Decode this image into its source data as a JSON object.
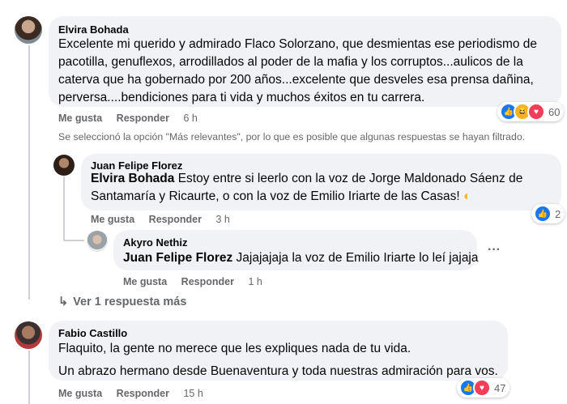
{
  "comments": [
    {
      "author": "Elvira Bohada",
      "text": "Excelente mi querido y admirado Flaco Solorzano, que desmientas ese periodismo de pacotilla, genuflexos, arrodillados al poder de la mafia y los corruptos...aulicos de la caterva que ha gobernado por 200 años...excelente que desveles esa prensa dañina, perversa....bendiciones para ti vida y muchos éxitos en tu carrera.",
      "like_label": "Me gusta",
      "reply_label": "Responder",
      "time": "6 h",
      "reaction_count": "60"
    }
  ],
  "filter_notice": "Se seleccionó la opción \"Más relevantes\", por lo que es posible que algunas respuestas se hayan filtrado.",
  "replies": [
    {
      "author": "Juan Felipe Florez",
      "tag": "Elvira Bohada",
      "text": "Estoy entre si leerlo con la voz de Jorge Maldonado Sáenz de Santamaría y Ricaurte, o con la voz de Emilio Iriarte de las Casas!",
      "like_label": "Me gusta",
      "reply_label": "Responder",
      "time": "3 h",
      "reaction_count": "2"
    },
    {
      "author": "Akyro Nethiz",
      "tag": "Juan Felipe Florez",
      "text": "Jajajajaja la voz de Emilio Iriarte lo leí jajaja",
      "like_label": "Me gusta",
      "reply_label": "Responder",
      "time": "1 h",
      "more": "···"
    }
  ],
  "view_more": "Ver 1 respuesta más",
  "comment2": {
    "author": "Fabio Castillo",
    "line1": "Flaquito, la gente no merece que les expliques nada de tu vida.",
    "line2": "Un abrazo hermano desde Buenaventura y toda nuestras admiración para vos.",
    "like_label": "Me gusta",
    "reply_label": "Responder",
    "time": "15 h",
    "reaction_count": "47"
  },
  "colors": {
    "like": "#1877f2",
    "haha": "#f7b125",
    "love": "#f33e58",
    "bubble": "#f0f2f5",
    "meta": "#65676b"
  },
  "icons": [
    "like-icon",
    "haha-icon",
    "love-icon",
    "crescent-moon-emoji",
    "reply-arrow-icon",
    "more-options-icon"
  ]
}
